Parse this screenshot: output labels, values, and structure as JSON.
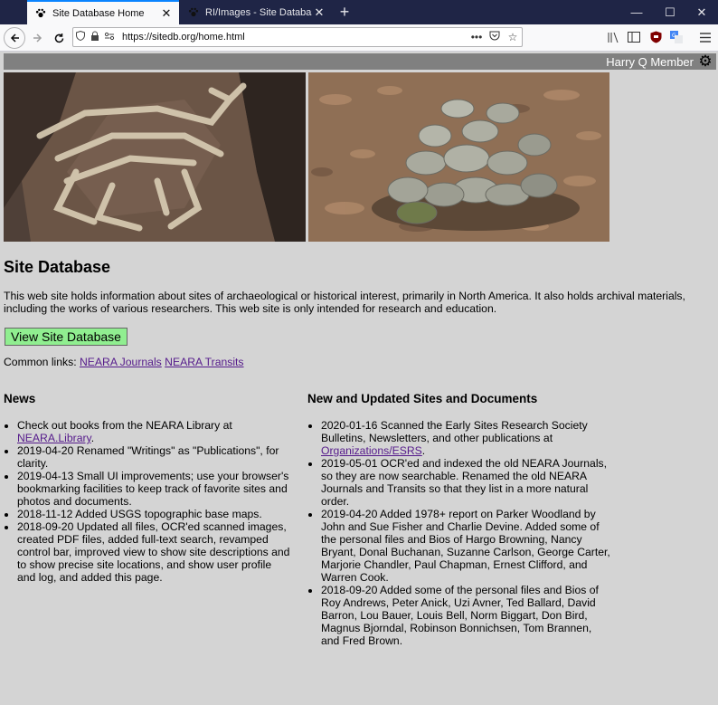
{
  "browser": {
    "tabs": [
      {
        "title": "Site Database Home",
        "active": true,
        "favicon": "paw-icon"
      },
      {
        "title": "RI/Images - Site Database",
        "active": false,
        "favicon": "paw-icon"
      }
    ],
    "new_tab": "+",
    "window_controls": {
      "minimize": "—",
      "maximize": "☐",
      "close": "✕"
    },
    "url": "https://sitedb.org/home.html",
    "page_actions": "•••"
  },
  "user": {
    "name": "Harry Q Member"
  },
  "page": {
    "title": "Site Database",
    "intro": "This web site holds information about sites of archaeological or historical interest, primarily in North America. It also holds archival materials, including the works of various researchers. This web site is only intended for research and education.",
    "view_button": "View Site Database",
    "common_links_label": "Common links:",
    "common_links": [
      "NEARA Journals",
      "NEARA Transits"
    ]
  },
  "news": {
    "heading": "News",
    "items": [
      {
        "before": "Check out books from the NEARA Library at ",
        "link": "NEARA.Library",
        "after": "."
      },
      {
        "before": "2019-04-20 Renamed \"Writings\" as \"Publications\", for clarity.",
        "link": "",
        "after": ""
      },
      {
        "before": "2019-04-13 Small UI improvements; use your browser's bookmarking facilities to keep track of favorite sites and photos and documents.",
        "link": "",
        "after": ""
      },
      {
        "before": "2018-11-12 Added USGS topographic base maps.",
        "link": "",
        "after": ""
      },
      {
        "before": "2018-09-20 Updated all files, OCR'ed scanned images, created PDF files, added full-text search, revamped control bar, improved view to show site descriptions and to show precise site locations, and show user profile and log, and added this page.",
        "link": "",
        "after": ""
      }
    ]
  },
  "updates": {
    "heading": "New and Updated Sites and Documents",
    "items": [
      {
        "before": "2020-01-16 Scanned the Early Sites Research Society Bulletins, Newsletters, and other publications at ",
        "link": "Organizations/ESRS",
        "after": "."
      },
      {
        "before": "2019-05-01 OCR'ed and indexed the old NEARA Journals, so they are now searchable. Renamed the old NEARA Journals and Transits so that they list in a more natural order.",
        "link": "",
        "after": ""
      },
      {
        "before": "2019-04-20 Added 1978+ report on Parker Woodland by John and Sue Fisher and Charlie Devine. Added some of the personal files and Bios of Hargo Browning, Nancy Bryant, Donal Buchanan, Suzanne Carlson, George Carter, Marjorie Chandler, Paul Chapman, Ernest Clifford, and Warren Cook.",
        "link": "",
        "after": ""
      },
      {
        "before": "2018-09-20 Added some of the personal files and Bios of Roy Andrews, Peter Anick, Uzi Avner, Ted Ballard, David Barron, Lou Bauer, Louis Bell, Norm Biggart, Don Bird, Magnus Bjorndal, Robinson Bonnichsen, Tom Brannen, and Fred Brown.",
        "link": "",
        "after": ""
      }
    ]
  }
}
